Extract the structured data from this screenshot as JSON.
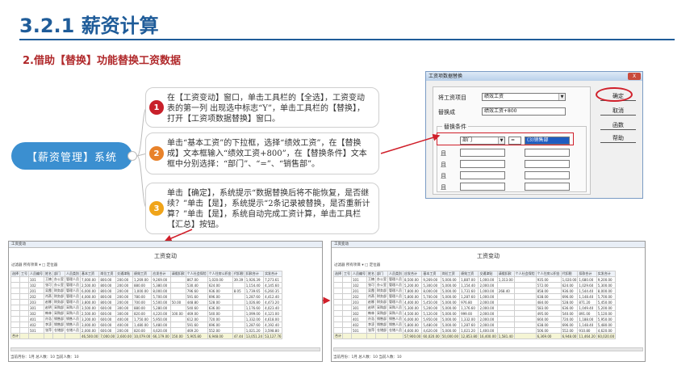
{
  "header": {
    "title": "3.2.1 薪资计算",
    "subtitle": "2.借助【替换】功能替换工资数据"
  },
  "mindmap": {
    "root": "【薪资管理】系统",
    "steps": [
      {
        "num": "1",
        "text": "在【工资变动】窗口，单击工具栏的【全选】，工资变动表的第一列 出现选中标志“Y”，单击工具栏的【替换】，打开【工资项数据替换】窗口。"
      },
      {
        "num": "2",
        "text": "单击“基本工资”的下拉框，选择“绩效工资”，在【替换成】文本框输入“绩效工资+800”，在【替换条件】文本框中分别选择：“部门”、“=”、“销售部”。"
      },
      {
        "num": "3",
        "text": "单击【确定】，系统提示“数据替换后将不能恢复，是否继续？”单击【是】，系统提示“2条记录被替换，是否重新计算？”单击【是】，系统自动完成工资计算，单击工具栏【汇总】按钮。"
      }
    ]
  },
  "dialog": {
    "title": "工资项数据替换",
    "close": "X",
    "label_item": "将工资项目",
    "item_value": "绩效工资",
    "label_replace": "替换成",
    "replace_value": "绩效工资+800",
    "cond_title": "替换条件",
    "cond_field": "部门",
    "cond_op": "=",
    "cond_value": "(3)销售部",
    "and_label": "且",
    "buttons": {
      "ok": "确定",
      "cancel": "取消",
      "func": "函数",
      "help": "帮助"
    }
  },
  "panel_left": {
    "titlebar": "工资变动",
    "heading": "工资变动",
    "toolbar": "过滤器  所有项目   ▾     □ 定位器",
    "headers": [
      "选择",
      "工号",
      "人员编号",
      "姓名",
      "部门",
      "人员类别",
      "基本工资",
      "岗位工资",
      "交通津贴",
      "绩效工资",
      "应发合计",
      "请假扣款",
      "个人社会保险",
      "个人住房公积金",
      "代扣税",
      "扣款合计",
      "实发合计"
    ],
    "rows": [
      [
        "",
        "",
        "101",
        "王楠",
        "办公室",
        "管理人员",
        "7,000.00",
        "800.00",
        "200.00",
        "1,269.00",
        "9,269.00",
        "",
        "867.00",
        "1,020.00",
        "39.39",
        "1,926.39",
        "7,273.61"
      ],
      [
        "",
        "",
        "102",
        "张可",
        "办公室",
        "管理人员",
        "2,500.00",
        "800.00",
        "200.00",
        "880.00",
        "5,380.00",
        "",
        "530.40",
        "624.00",
        "",
        "1,154.40",
        "4,145.60"
      ],
      [
        "",
        "",
        "201",
        "吴霞",
        "财务部",
        "管理人员",
        "6,000.00",
        "800.00",
        "200.00",
        "1,000.00",
        "8,000.00",
        "",
        "796.60",
        "936.00",
        "8.05",
        "1,739.65",
        "6,260.35"
      ],
      [
        "",
        "",
        "202",
        "肖燕",
        "财务部",
        "管理人员",
        "4,000.00",
        "800.00",
        "200.00",
        "780.00",
        "5,700.00",
        "",
        "591.60",
        "696.00",
        "",
        "1,287.60",
        "4,412.40"
      ],
      [
        "",
        "",
        "203",
        "赵娜",
        "财务部",
        "管理人员",
        "3,800.00",
        "800.00",
        "200.00",
        "700.00",
        "5,500.00",
        "50.00",
        "448.80",
        "528.00",
        "",
        "1,026.80",
        "4,473.20"
      ],
      [
        "",
        "",
        "301",
        "赵明",
        "采购部",
        "采购人员",
        "3,500.00",
        "600.00",
        "300.00",
        "880.00",
        "5,280.00",
        "",
        "540.60",
        "636.00",
        "",
        "1,176.60",
        "4,023.40"
      ],
      [
        "",
        "",
        "302",
        "韩林",
        "采购部",
        "采购人员",
        "2,500.00",
        "600.00",
        "300.00",
        "820.00",
        "4,220.00",
        "100.00",
        "469.00",
        "540.00",
        "",
        "1,099.00",
        "4,121.00"
      ],
      [
        "",
        "",
        "401",
        "孙浩",
        "销售部",
        "销售人员",
        "3,200.00",
        "600.00",
        "400.00",
        "1,750.00",
        "5,950.00",
        "",
        "612.00",
        "720.00",
        "",
        "1,332.00",
        "4,618.00"
      ],
      [
        "",
        "",
        "402",
        "李凌",
        "销售部",
        "销售人员",
        "3,000.00",
        "600.00",
        "400.00",
        "1,480.00",
        "5,480.00",
        "",
        "591.60",
        "696.00",
        "",
        "1,287.60",
        "4,192.40"
      ],
      [
        "",
        "",
        "501",
        "张萍",
        "仓储部",
        "仓储人员",
        "2,000.00",
        "600.00",
        "200.00",
        "820.00",
        "4,620.00",
        "",
        "469.20",
        "552.00",
        "",
        "1,021.20",
        "3,598.80"
      ]
    ],
    "total": [
      "合计",
      "",
      "",
      "",
      "",
      "",
      "46,500.00",
      "7,000.00",
      "2,600.00",
      "10,079.00",
      "66,179.00",
      "150.00",
      "5,905.80",
      "6,948.00",
      "47.44",
      "13,051.24",
      "53,127.76"
    ],
    "status": "当前月份：1月          总人数：10                                  当前人数：10"
  },
  "panel_right": {
    "titlebar": "工资变动",
    "heading": "工资变动",
    "toolbar": "过滤器  所有项目   ▾     □ 定位器",
    "headers": [
      "选择",
      "工号",
      "人员编号",
      "姓名",
      "部门",
      "人员类别",
      "应发合计",
      "基本工资",
      "岗位工资",
      "绩效工资",
      "交通津贴",
      "请假扣款",
      "个人社会保险",
      "个人住房公积金",
      "代扣税",
      "扣款合计",
      "实发合计"
    ],
    "rows": [
      [
        "",
        "",
        "101",
        "王楠",
        "办公室",
        "管理人员",
        "8,500.00",
        "9,269.00",
        "5,000.00",
        "1,887.00",
        "1,000.00",
        "1,313.00",
        "",
        "935.00",
        "1,020.00",
        "1,680.00",
        "9,200.00"
      ],
      [
        "",
        "",
        "102",
        "张可",
        "办公室",
        "管理人员",
        "5,200.00",
        "5,300.00",
        "5,000.00",
        "1,154.40",
        "2,000.00",
        "",
        "",
        "572.00",
        "624.00",
        "1,029.60",
        "5,300.00"
      ],
      [
        "",
        "",
        "201",
        "吴霞",
        "财务部",
        "管理人员",
        "7,800.00",
        "8,000.00",
        "5,000.00",
        "1,731.60",
        "1,000.00",
        "268.40",
        "",
        "858.00",
        "936.00",
        "1,544.40",
        "8,000.00"
      ],
      [
        "",
        "",
        "202",
        "肖燕",
        "财务部",
        "管理人员",
        "5,800.00",
        "5,700.00",
        "5,000.00",
        "1,287.60",
        "1,000.00",
        "",
        "",
        "638.00",
        "696.00",
        "1,148.40",
        "5,700.00"
      ],
      [
        "",
        "",
        "203",
        "赵娜",
        "财务部",
        "管理人员",
        "4,400.00",
        "5,450.00",
        "5,000.00",
        "976.80",
        "2,000.00",
        "",
        "",
        "484.00",
        "528.00",
        "871.20",
        "5,450.00"
      ],
      [
        "",
        "",
        "301",
        "赵明",
        "采购部",
        "采购人员",
        "5,300.00",
        "5,200.00",
        "5,000.00",
        "1,176.60",
        "2,000.00",
        "",
        "",
        "583.00",
        "636.00",
        "1,049.40",
        "5,200.00"
      ],
      [
        "",
        "",
        "302",
        "韩林",
        "采购部",
        "采购人员",
        "4,500.00",
        "5,120.00",
        "5,000.00",
        "999.00",
        "2,000.00",
        "",
        "",
        "495.00",
        "540.00",
        "891.00",
        "5,120.00"
      ],
      [
        "",
        "",
        "401",
        "孙浩",
        "销售部",
        "销售人员",
        "6,000.00",
        "5,950.00",
        "5,000.00",
        "1,332.00",
        "2,000.00",
        "",
        "",
        "660.00",
        "720.00",
        "1,188.00",
        "5,950.00"
      ],
      [
        "",
        "",
        "402",
        "李凌",
        "销售部",
        "销售人员",
        "5,800.00",
        "5,480.00",
        "5,000.00",
        "1,287.60",
        "2,000.00",
        "",
        "",
        "638.00",
        "696.00",
        "1,148.40",
        "5,480.00"
      ],
      [
        "",
        "",
        "501",
        "张萍",
        "仓储部",
        "仓储人员",
        "4,600.00",
        "4,620.00",
        "5,000.00",
        "1,021.20",
        "1,400.00",
        "",
        "",
        "506.00",
        "552.00",
        "910.80",
        "4,620.00"
      ]
    ],
    "total": [
      "合计",
      "",
      "",
      "",
      "",
      "",
      "57,900.00",
      "60,020.00",
      "50,000.00",
      "12,853.80",
      "16,400.00",
      "1,581.40",
      "",
      "6,369.00",
      "6,948.00",
      "11,464.20",
      "60,020.00"
    ],
    "status": "当前月份：1月          总人数：10                                  当前人数：10"
  },
  "colors": {
    "title": "#1f5c99",
    "subtitle": "#b0282a",
    "root": "#3b8fd0",
    "arrow": "#d01f2a"
  }
}
